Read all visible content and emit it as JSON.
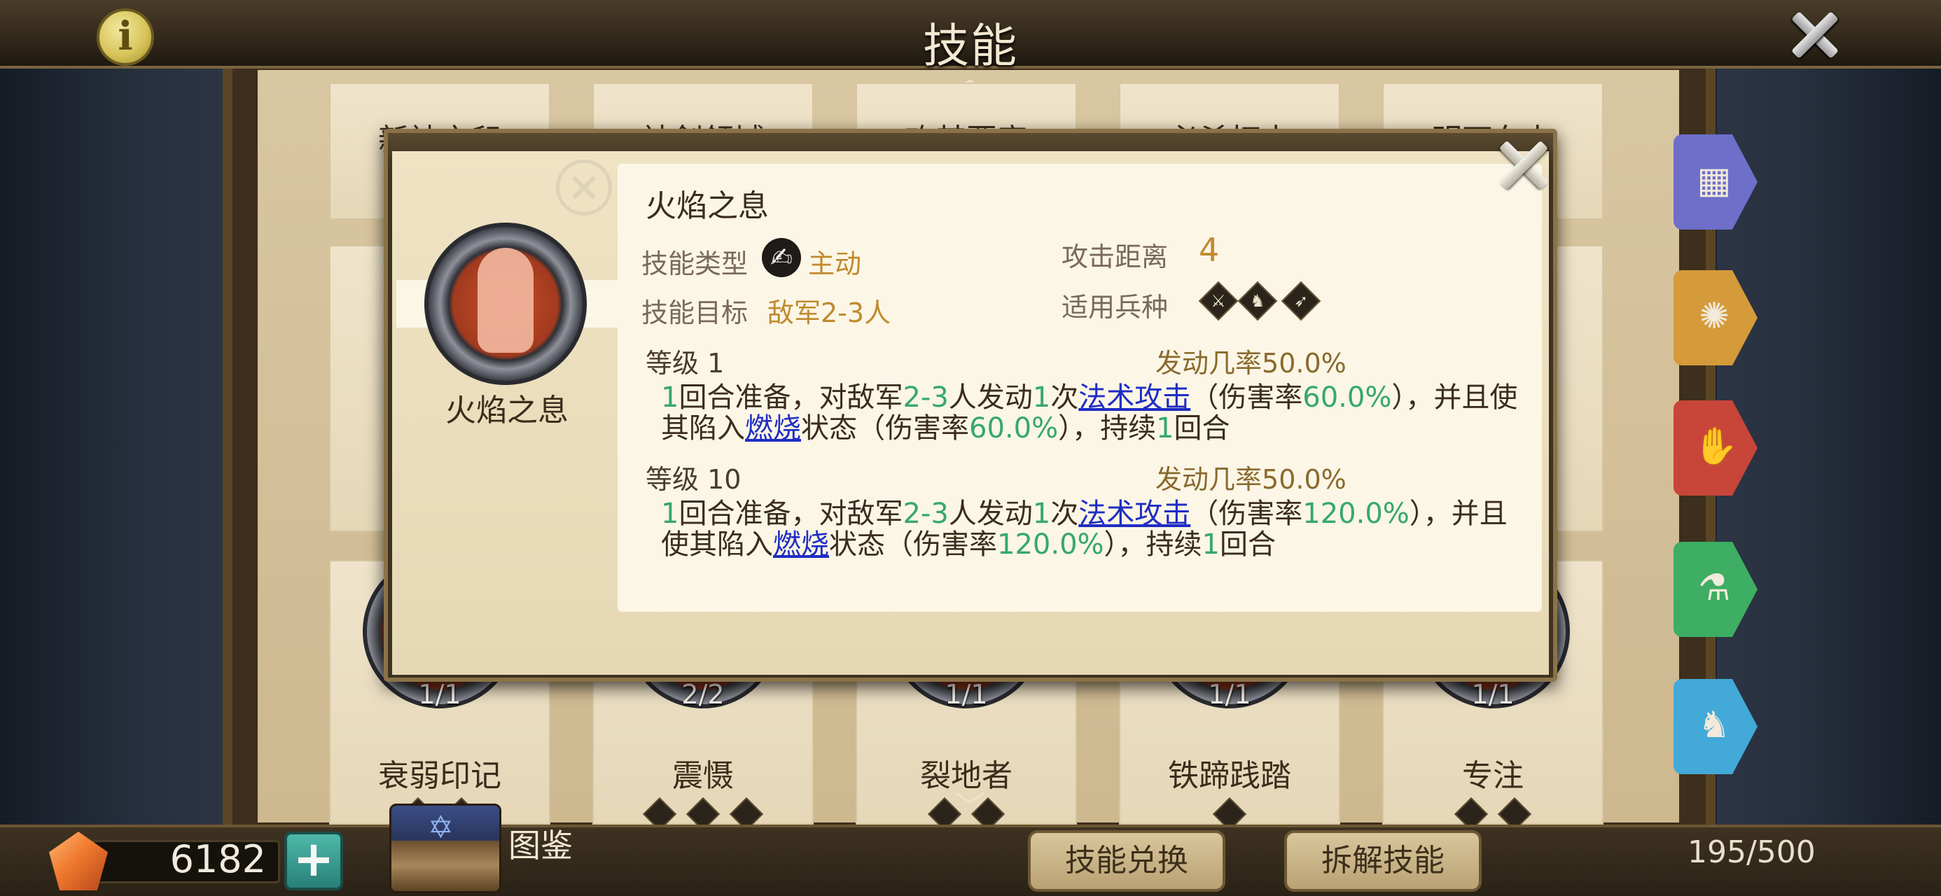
{
  "header": {
    "title": "技能",
    "info_glyph": "i"
  },
  "cards_row1": [
    {
      "name": "新神之印"
    },
    {
      "name": "神剑领域"
    },
    {
      "name": "攻其要害"
    },
    {
      "name": "必杀打击"
    },
    {
      "name": "明石车力"
    }
  ],
  "cards_row3": [
    {
      "name": "衰弱印记",
      "count": "1/1"
    },
    {
      "name": "震慑",
      "count": "2/2"
    },
    {
      "name": "裂地者",
      "count": "1/1"
    },
    {
      "name": "铁蹄践踏",
      "count": "1/1"
    },
    {
      "name": "专注",
      "count": "1/1"
    }
  ],
  "side_tabs": [
    {
      "icon": "grid-icon",
      "color": "#6d6fc9"
    },
    {
      "icon": "compass-icon",
      "color": "#d59a3a"
    },
    {
      "icon": "flame-hand-icon",
      "color": "#c8453a"
    },
    {
      "icon": "potion-icon",
      "color": "#3dae63"
    },
    {
      "icon": "horse-icon",
      "color": "#43a9d8"
    }
  ],
  "footer": {
    "gems": "6182",
    "codex_label": "图鉴",
    "exchange_button": "技能兑换",
    "dismantle_button": "拆解技能",
    "capacity": "195/500"
  },
  "popup": {
    "icon_name": "火焰之息",
    "title": "火焰之息",
    "type_label": "技能类型",
    "type_value": "主动",
    "target_label": "技能目标",
    "target_value": "敌军2-3人",
    "range_label": "攻击距离",
    "range_value": "4",
    "unit_label": "适用兵种",
    "levels": [
      {
        "level": "等级 1",
        "rate_label": "发动几率",
        "rate_value": "50.0%",
        "d": [
          "1",
          "回合准备，对敌军",
          "2-3",
          "人发动",
          "1",
          "次",
          "法术攻击",
          "（伤害率",
          "60.0%",
          "），并且使",
          "其陷入",
          "燃烧",
          "状态（伤害率",
          "60.0%",
          "），持续",
          "1",
          "回合"
        ]
      },
      {
        "level": "等级 10",
        "rate_label": "发动几率",
        "rate_value": "50.0%",
        "d": [
          "1",
          "回合准备，对敌军",
          "2-3",
          "人发动",
          "1",
          "次",
          "法术攻击",
          "（伤害率",
          "120.0%",
          "），并且",
          "使其陷入",
          "燃烧",
          "状态（伤害率",
          "120.0%",
          "），持续",
          "1",
          "回合"
        ]
      }
    ]
  },
  "colors": {
    "accent_orange": "#c08a2e",
    "value_green": "#37a86a",
    "link_blue": "#1f2dc4"
  }
}
